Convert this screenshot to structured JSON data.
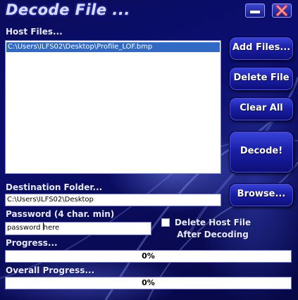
{
  "window": {
    "title": "Decode File ..."
  },
  "host_files": {
    "label": "Host Files...",
    "items": [
      "C:\\Users\\ILFS02\\Desktop\\Profile_LOF.bmp"
    ]
  },
  "buttons": {
    "add_files": "Add Files...",
    "delete_file": "Delete File",
    "clear_all": "Clear All",
    "decode": "Decode!",
    "browse": "Browse..."
  },
  "destination": {
    "label": "Destination Folder...",
    "value": "C:\\Users\\ILFS02\\Desktop"
  },
  "password": {
    "label": "Password (4 char. min)",
    "value_before_caret": "password ",
    "value_after_caret": "here"
  },
  "delete_host": {
    "label_line1": "Delete Host File",
    "label_line2": "After Decoding",
    "checked": false
  },
  "progress": {
    "label": "Progress...",
    "percent_text": "0%",
    "value": 0
  },
  "overall_progress": {
    "label": "Overall Progress...",
    "percent_text": "0%",
    "value": 0
  },
  "colors": {
    "background": "#0b0e70",
    "button": "#1a1fa6",
    "selection": "#316ac5"
  }
}
